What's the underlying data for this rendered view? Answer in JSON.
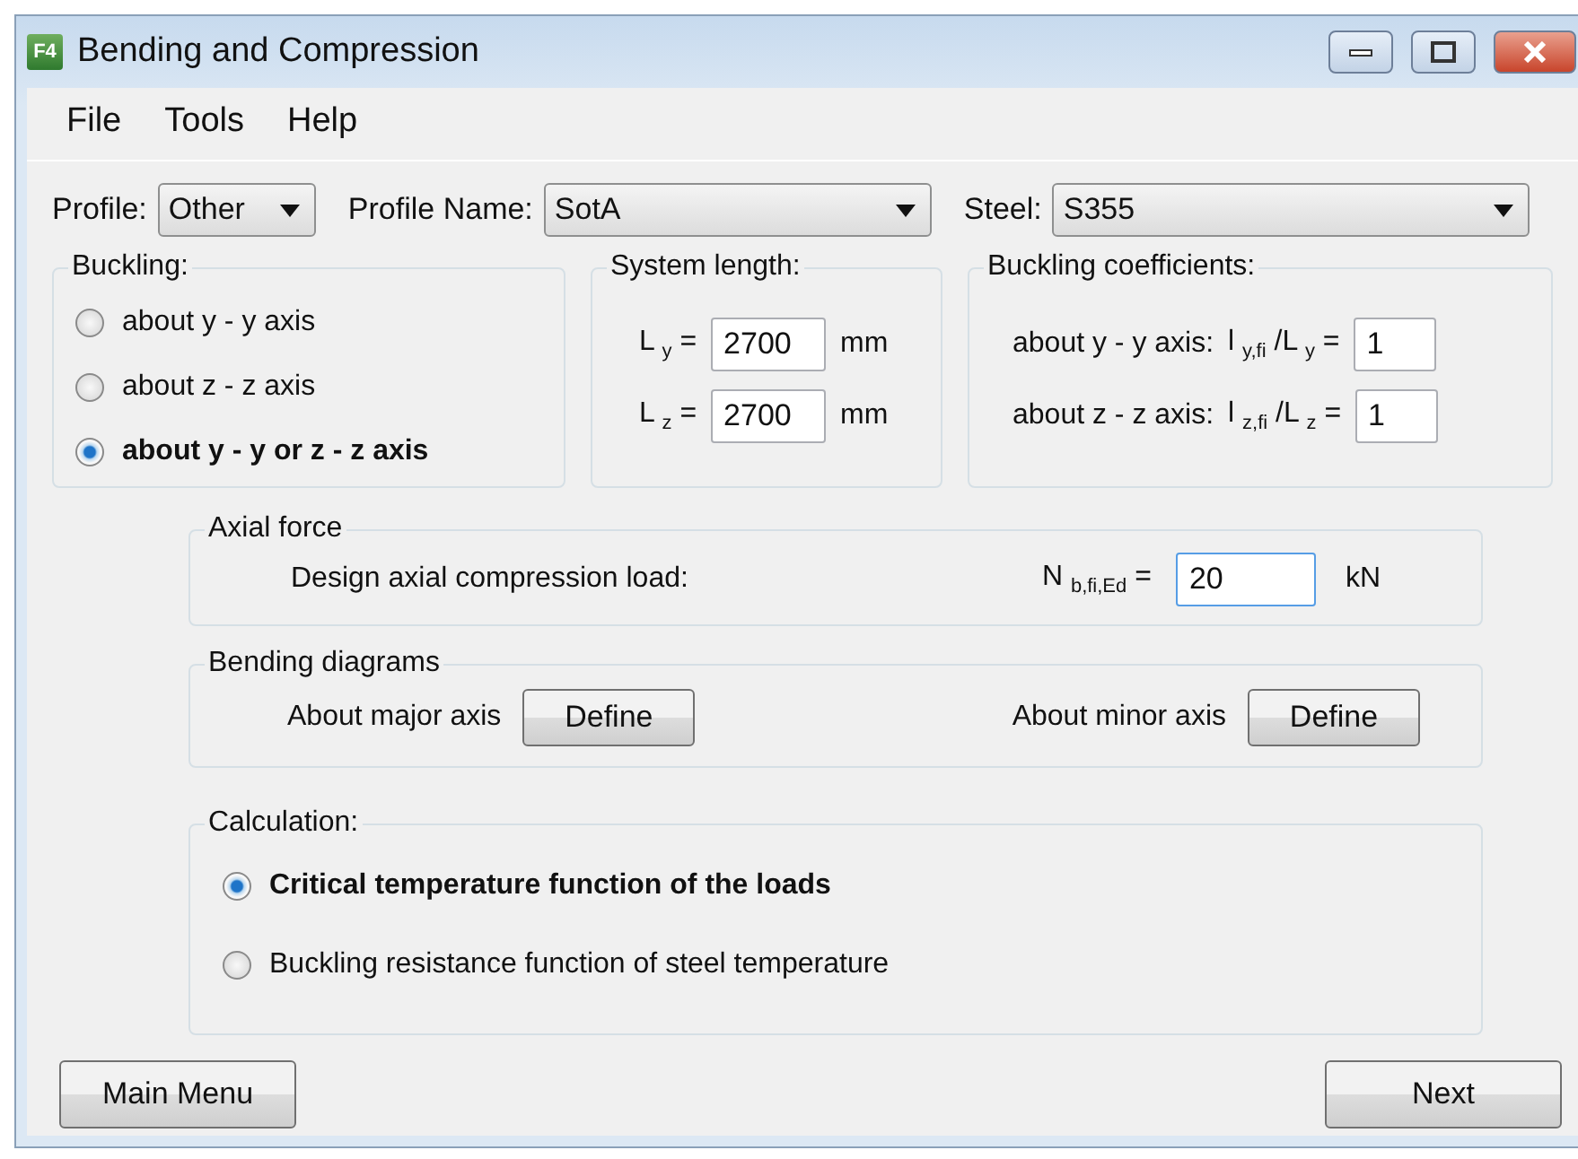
{
  "window": {
    "title": "Bending and Compression",
    "icon_text": "F4"
  },
  "menu": [
    "File",
    "Tools",
    "Help"
  ],
  "selectors": [
    {
      "label": "Profile:",
      "value": "Other"
    },
    {
      "label": "Profile Name:",
      "value": "SotA"
    },
    {
      "label": "Steel:",
      "value": "S355"
    }
  ],
  "buckling": {
    "title": "Buckling:",
    "options": [
      {
        "label": "about y - y axis",
        "selected": false
      },
      {
        "label": "about z - z axis",
        "selected": false
      },
      {
        "label": "about y - y or z - z axis",
        "selected": true
      }
    ]
  },
  "system_length": {
    "title": "System length:",
    "fields": [
      {
        "symbol": "L $_{y}$ =",
        "value": "2700",
        "unit": "mm"
      },
      {
        "symbol": "L $_{z}$ =",
        "value": "2700",
        "unit": "mm"
      }
    ]
  },
  "buckling_coefficients": {
    "title": "Buckling coefficients:",
    "rows": [
      {
        "label": "about y - y axis:",
        "symbol": "l $_{y,fi}$ /L $_{y}$ =",
        "value": "1"
      },
      {
        "label": "about z - z axis:",
        "symbol": "l $_{z,fi}$ /L $_{z}$ =",
        "value": "1"
      }
    ]
  },
  "axial_force": {
    "title": "Axial force",
    "label": "Design axial compression load:",
    "symbol": "N $_{b,fi,Ed}$ =",
    "value": "20",
    "unit": "kN"
  },
  "bending_diagrams": {
    "title": "Bending diagrams",
    "items": [
      {
        "label": "About major axis",
        "button": "Define"
      },
      {
        "label": "About minor axis",
        "button": "Define"
      }
    ]
  },
  "calculation": {
    "title": "Calculation:",
    "options": [
      {
        "label": "Critical temperature function of the loads",
        "selected": true
      },
      {
        "label": "Buckling resistance function of steel temperature",
        "selected": false
      }
    ]
  },
  "buttons": [
    "Main Menu",
    "Next"
  ]
}
